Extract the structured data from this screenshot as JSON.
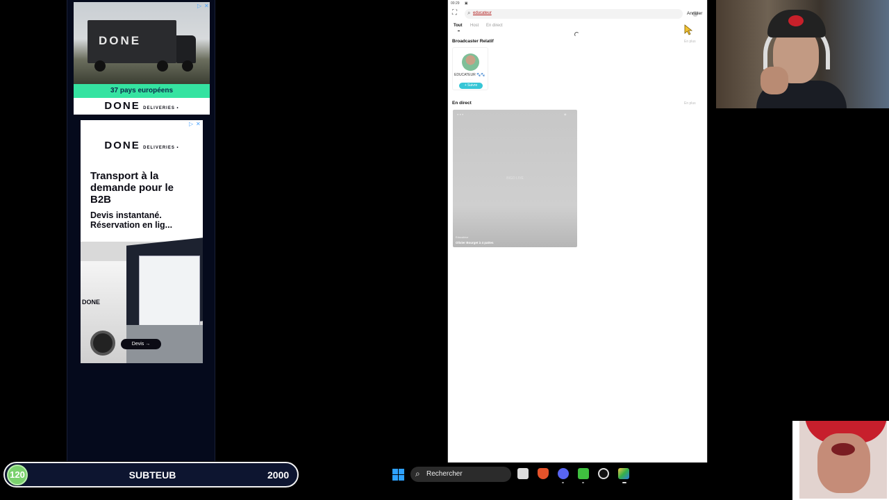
{
  "ads": {
    "ad1": {
      "truck_logo": "DONE",
      "band_text": "37 pays européens",
      "brand": "DONE",
      "brand_suffix": "DELIVERIES •"
    },
    "ad2": {
      "brand": "DONE",
      "brand_suffix": "DELIVERIES •",
      "headline": "Transport à la demande pour le B2B",
      "subline": "Devis instantané. Réservation en lig...",
      "cta": "Devis →",
      "truck_logo": "DONE"
    }
  },
  "app": {
    "status_time": "00:29",
    "search": {
      "query": "educateur",
      "cancel_label": "Annuler"
    },
    "tabs": [
      "Tout",
      "Host",
      "En direct"
    ],
    "active_tab": "Tout",
    "sections": {
      "broadcaster_title": "Broadcaster Relatif",
      "broadcaster_more": "En plus",
      "live_title": "En direct",
      "live_more": "En plus"
    },
    "broadcaster": {
      "name": "EDUCATEUR 🐾🐾",
      "follow_label": "+ Suivre"
    },
    "live_card": {
      "watermark": "BIGO LIVE",
      "host": "Educateur",
      "title": "Olivier Bourget à 4 pattes"
    }
  },
  "overlay": {
    "sub_count": "120",
    "sub_label": "SUBTEUB",
    "sub_goal": "2000"
  },
  "taskbar": {
    "search_placeholder": "Rechercher",
    "icons": [
      "windows-icon",
      "search-icon",
      "file-explorer-icon",
      "brave-icon",
      "discord-icon",
      "phone-link-icon",
      "settings-icon",
      "bluestacks-icon"
    ]
  },
  "colors": {
    "ad_accent": "#35e3a1",
    "follow_button": "#37c6d6",
    "sub_badge": "#7bd16e",
    "windows_blue": "#2ea1ff"
  }
}
